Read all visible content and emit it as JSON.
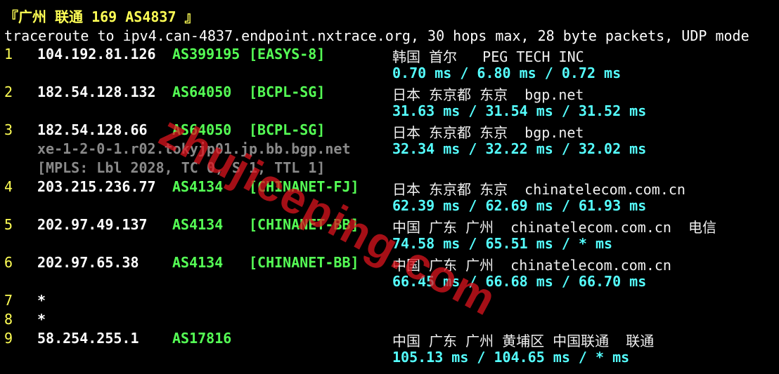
{
  "title": "『广州 联通 169 AS4837 』",
  "header": "traceroute to ipv4.can-4837.endpoint.nxtrace.org, 30 hops max, 28 byte packets, UDP mode",
  "hops": [
    {
      "num": "1",
      "ip": "104.192.81.126",
      "asn": "AS399195",
      "tag": "[EASYS-8]",
      "geo": "韩国 首尔   PEG TECH INC",
      "rtt": "0.70 ms / 6.80 ms / 0.72 ms"
    },
    {
      "num": "2",
      "ip": "182.54.128.132",
      "asn": "AS64050",
      "tag": "[BCPL-SG]",
      "geo": "日本 东京都 东京  bgp.net",
      "rtt": "31.63 ms / 31.54 ms / 31.52 ms"
    },
    {
      "num": "3",
      "ip": "182.54.128.66",
      "asn": "AS64050",
      "tag": "[BCPL-SG]",
      "geo": "日本 东京都 东京  bgp.net",
      "rtt": "32.34 ms / 32.22 ms / 32.02 ms",
      "rdns": "xe-1-2-0-1.r02.tokyjp01.jp.bb.bgp.net",
      "mpls": "[MPLS: Lbl 2028, TC 0, S 1, TTL 1]"
    },
    {
      "num": "4",
      "ip": "203.215.236.77",
      "asn": "AS4134",
      "tag": "[CHINANET-FJ]",
      "geo": "日本 东京都 东京  chinatelecom.com.cn",
      "rtt": "62.39 ms / 62.69 ms / 61.93 ms"
    },
    {
      "num": "5",
      "ip": "202.97.49.137",
      "asn": "AS4134",
      "tag": "[CHINANET-BB]",
      "geo": "中国 广东 广州  chinatelecom.com.cn  电信",
      "rtt": "74.58 ms / 65.51 ms / * ms"
    },
    {
      "num": "6",
      "ip": "202.97.65.38",
      "asn": "AS4134",
      "tag": "[CHINANET-BB]",
      "geo": "中国 广东 广州  chinatelecom.com.cn",
      "rtt": "66.45 ms / 66.68 ms / 66.70 ms"
    },
    {
      "num": "7",
      "ip": "*"
    },
    {
      "num": "8",
      "ip": "*"
    },
    {
      "num": "9",
      "ip": "58.254.255.1",
      "asn": "AS17816",
      "tag": "",
      "geo": "中国 广东 广州 黄埔区 中国联通  联通",
      "rtt": "105.13 ms / 104.65 ms / * ms"
    }
  ],
  "watermark": "zhujiceping.com"
}
